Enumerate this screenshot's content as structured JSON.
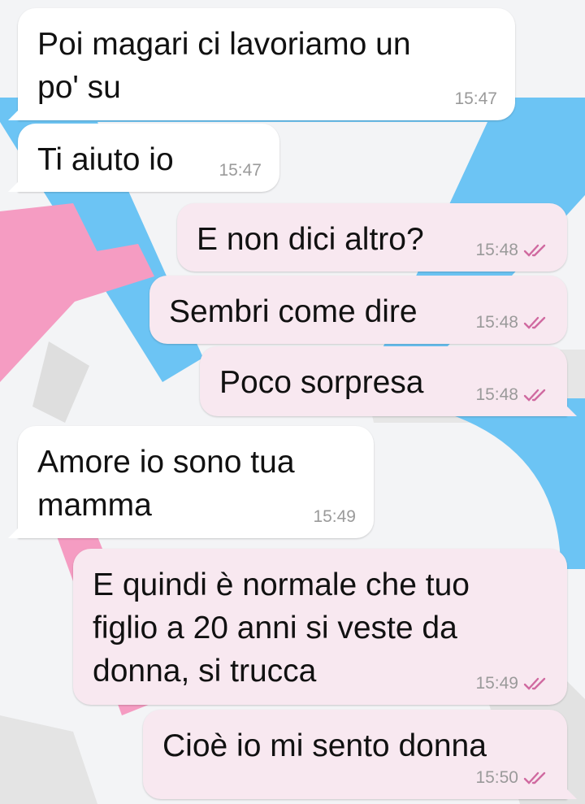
{
  "messages": [
    {
      "direction": "in",
      "text": "Poi magari ci lavoriamo un\npo' su",
      "time": "15:47"
    },
    {
      "direction": "in",
      "text": "Ti aiuto io",
      "time": "15:47"
    },
    {
      "direction": "out",
      "text": "E non dici altro?",
      "time": "15:48",
      "status_icon": "double-check-icon"
    },
    {
      "direction": "out",
      "text": "Sembri come dire",
      "time": "15:48",
      "status_icon": "double-check-icon"
    },
    {
      "direction": "out",
      "text": "Poco sorpresa",
      "time": "15:48",
      "status_icon": "double-check-icon"
    },
    {
      "direction": "in",
      "text": "Amore io sono tua\nmamma",
      "time": "15:49"
    },
    {
      "direction": "out",
      "text": "E quindi è normale che tuo\nfiglio a 20 anni si veste da\ndonna, si trucca",
      "time": "15:49",
      "status_icon": "double-check-icon"
    },
    {
      "direction": "out",
      "text": "Cioè io mi sento donna",
      "time": "15:50",
      "status_icon": "double-check-icon"
    }
  ],
  "colors": {
    "incoming_bubble": "#ffffff",
    "outgoing_bubble": "#f8e8f0",
    "read_ticks": "#d06aa0",
    "wallpaper_blue": "#6cc4f4",
    "wallpaper_pink": "#f59cc2"
  }
}
